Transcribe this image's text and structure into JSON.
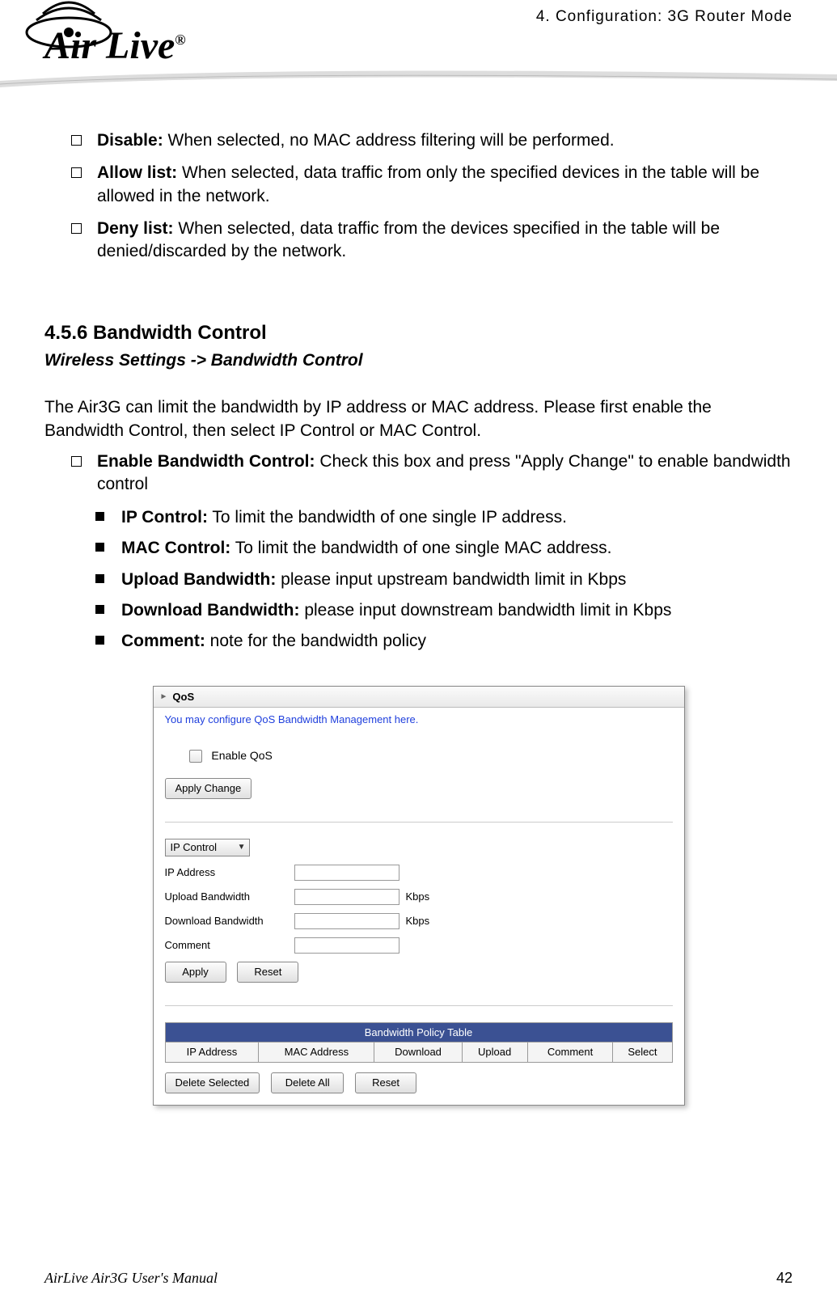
{
  "header": {
    "chapter": "4. Configuration: 3G Router Mode",
    "logo_text": "Air Live",
    "logo_reg": "®"
  },
  "mac_filter": {
    "items": [
      {
        "term": "Disable:",
        "desc": " When selected, no MAC address filtering will be performed."
      },
      {
        "term": "Allow list:",
        "desc": " When selected, data traffic from only the specified devices in the table will be allowed in the network."
      },
      {
        "term": "Deny list:",
        "desc": " When selected, data traffic from the devices specified in the table will be denied/discarded by the network."
      }
    ]
  },
  "section": {
    "number_title": "4.5.6 Bandwidth Control",
    "breadcrumb": "Wireless Settings -> Bandwidth Control",
    "intro": "The Air3G can limit the bandwidth by IP address or MAC address.   Please first enable the Bandwidth Control, then select IP Control or MAC Control.",
    "enable_item": {
      "term": "Enable Bandwidth Control:",
      "desc": "   Check this box and press \"Apply Change\" to enable bandwidth control"
    },
    "sub_items": [
      {
        "term": "IP Control:",
        "desc": "   To limit the bandwidth of one single IP address."
      },
      {
        "term": "MAC Control:",
        "desc": "   To limit the bandwidth of one single MAC address."
      },
      {
        "term": "Upload Bandwidth:",
        "desc": "   please input upstream bandwidth limit in Kbps"
      },
      {
        "term": "Download Bandwidth:",
        "desc": " please input downstream bandwidth limit in Kbps"
      },
      {
        "term": "Comment:",
        "desc": "   note for the bandwidth policy"
      }
    ]
  },
  "qos": {
    "title": "QoS",
    "note": "You may configure QoS Bandwidth Management here.",
    "enable_label": "Enable QoS",
    "apply_change": "Apply Change",
    "control_select": "IP Control",
    "rows": {
      "ip_address": "IP Address",
      "upload": "Upload Bandwidth",
      "download": "Download Bandwidth",
      "comment": "Comment",
      "unit": "Kbps"
    },
    "apply": "Apply",
    "reset": "Reset",
    "table_caption": "Bandwidth Policy Table",
    "cols": [
      "IP Address",
      "MAC Address",
      "Download",
      "Upload",
      "Comment",
      "Select"
    ],
    "delete_selected": "Delete Selected",
    "delete_all": "Delete All",
    "reset2": "Reset"
  },
  "footer": {
    "manual": "AirLive Air3G User's Manual",
    "page": "42"
  }
}
